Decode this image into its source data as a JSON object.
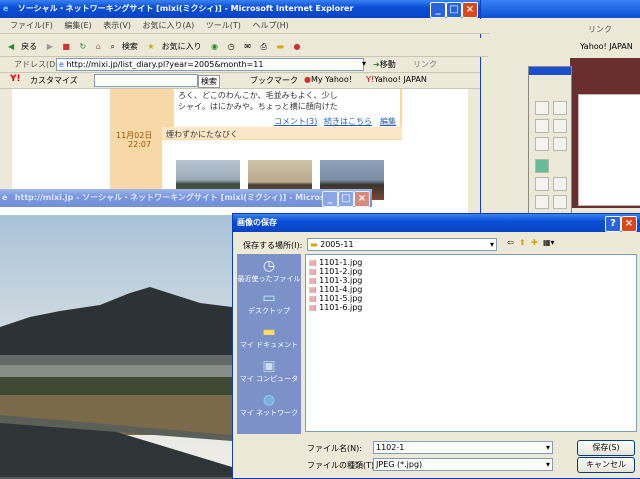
{
  "ie_window": {
    "title": "ソーシャル・ネットワーキングサイト [mixi(ミクシィ)] - Microsoft Internet Explorer",
    "menu": [
      "ファイル(F)",
      "編集(E)",
      "表示(V)",
      "お気に入り(A)",
      "ツール(T)",
      "ヘルプ(H)"
    ],
    "toolbar": {
      "back": "戻る",
      "search": "検索",
      "favorites": "お気に入り"
    },
    "address_label": "アドレス(D)",
    "url": "http://mixi.jp/list_diary.pl?year=2005&month=11",
    "go": "移動",
    "links": "リンク",
    "yahoo_bar": {
      "customize": "カスタマイズ",
      "search_btn": "検索",
      "bookmark": "ブックマーク",
      "my_yahoo": "My Yahoo!",
      "yahoo_japan": "Yahoo! JAPAN"
    }
  },
  "diary": {
    "text_line1": "ろく、どこのわんこか、毛並みもよく、少し",
    "text_line2": "シャイ。はにかみや。ちょっと横に顔向けた",
    "comment_link": "コメント(3)",
    "more_link": "続きはこちら",
    "edit_link": "編集",
    "date": "11月02日",
    "time": "22:07",
    "entry_title": "煙わずかにたなびく"
  },
  "bg_window": {
    "links": "リンク",
    "yahoo_japan": "Yahoo! JAPAN"
  },
  "photo_window": {
    "title": "http://mixi.jp - ソーシャル・ネットワーキングサイト [mixi(ミクシィ)] - Micros..."
  },
  "save_dialog": {
    "title": "画像の保存",
    "save_in_label": "保存する場所(I):",
    "folder": "2005-11",
    "places": [
      "最近使ったファイル",
      "デスクトップ",
      "マイ ドキュメント",
      "マイ コンピュータ",
      "マイ ネットワーク"
    ],
    "files": [
      "1101-1.jpg",
      "1101-2.jpg",
      "1101-3.jpg",
      "1101-4.jpg",
      "1101-5.jpg",
      "1101-6.jpg"
    ],
    "filename_label": "ファイル名(N):",
    "filename_value": "1102-1",
    "filetype_label": "ファイルの種類(T):",
    "filetype_value": "JPEG (*.jpg)",
    "save_button": "保存(S)",
    "cancel_button": "キャンセル"
  }
}
